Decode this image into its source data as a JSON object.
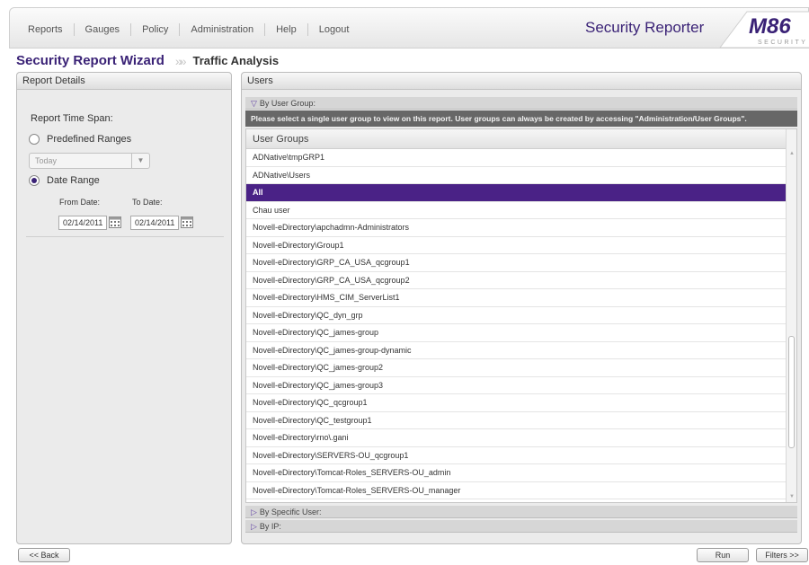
{
  "menu": [
    "Reports",
    "Gauges",
    "Policy",
    "Administration",
    "Help",
    "Logout"
  ],
  "app_title": "Security Reporter",
  "logo": {
    "brand": "M86",
    "sub": "SECURITY"
  },
  "breadcrumb": {
    "main": "Security Report Wizard",
    "sub": "Traffic Analysis"
  },
  "report_details": {
    "header": "Report Details",
    "time_span_label": "Report Time Span:",
    "predefined_label": "Predefined Ranges",
    "predefined_value": "Today",
    "date_range_label": "Date Range",
    "from_label": "From Date:",
    "to_label": "To Date:",
    "from_value": "02/14/2011",
    "to_value": "02/14/2011"
  },
  "users": {
    "header": "Users",
    "by_group_label": "By User Group:",
    "info": "Please select a single user group to view on this report. User groups can always be created by accessing \"Administration/User Groups\".",
    "list_header": "User Groups",
    "groups": [
      "ADNative\\tmpGRP1",
      "ADNative\\Users",
      "All",
      "Chau user",
      "Novell-eDirectory\\apchadmn-Administrators",
      "Novell-eDirectory\\Group1",
      "Novell-eDirectory\\GRP_CA_USA_qcgroup1",
      "Novell-eDirectory\\GRP_CA_USA_qcgroup2",
      "Novell-eDirectory\\HMS_CIM_ServerList1",
      "Novell-eDirectory\\QC_dyn_grp",
      "Novell-eDirectory\\QC_james-group",
      "Novell-eDirectory\\QC_james-group-dynamic",
      "Novell-eDirectory\\QC_james-group2",
      "Novell-eDirectory\\QC_james-group3",
      "Novell-eDirectory\\QC_qcgroup1",
      "Novell-eDirectory\\QC_testgroup1",
      "Novell-eDirectory\\rno\\.gani",
      "Novell-eDirectory\\SERVERS-OU_qcgroup1",
      "Novell-eDirectory\\Tomcat-Roles_SERVERS-OU_admin",
      "Novell-eDirectory\\Tomcat-Roles_SERVERS-OU_manager"
    ],
    "selected_group": "All",
    "by_specific_user_label": "By Specific User:",
    "by_ip_label": "By IP:"
  },
  "footer": {
    "back": "<< Back",
    "run": "Run",
    "filters": "Filters >>"
  },
  "colors": {
    "brand_purple": "#3a2276",
    "selected_row": "#4a2286",
    "info_bar": "#676767"
  }
}
